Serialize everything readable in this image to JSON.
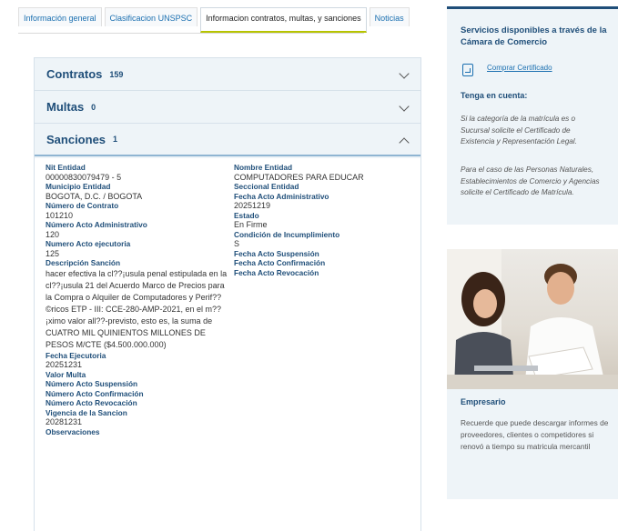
{
  "tabs": [
    {
      "label": "Información general"
    },
    {
      "label": "Clasificacion UNSPSC"
    },
    {
      "label": "Informacion contratos, multas, y sanciones"
    },
    {
      "label": "Noticias"
    }
  ],
  "sections": {
    "contratos": {
      "title": "Contratos",
      "count": "159"
    },
    "multas": {
      "title": "Multas",
      "count": "0"
    },
    "sanciones": {
      "title": "Sanciones",
      "count": "1"
    }
  },
  "sancion": {
    "nit_label": "Nit Entidad",
    "nit_value": "00000830079479 - 5",
    "municipio_label": "Municipio Entidad",
    "municipio_value": "BOGOTA, D.C. / BOGOTA",
    "contrato_label": "Número de Contrato",
    "contrato_value": "101210",
    "acto_adm_label": "Número Acto Administrativo",
    "acto_adm_value": "120",
    "acto_ejec_label": "Numero Acto ejecutoria",
    "acto_ejec_value": "125",
    "descripcion_label": "Descripción Sanción",
    "descripcion_value": "hacer efectiva la cl??¡usula penal estipulada en la cl??¡usula 21 del Acuerdo Marco de Precios para la Compra o Alquiler de Computadores y Perif??©ricos ETP - III: CCE-280-AMP-2021, en el m??¡ximo valor all??-previsto, esto es, la suma de CUATRO MIL QUINIENTOS MILLONES DE PESOS M/CTE ($4.500.000.000)",
    "fecha_ejec_label": "Fecha Ejecutoria",
    "fecha_ejec_value": "20251231",
    "valor_multa_label": "Valor Multa",
    "acto_susp_label": "Número Acto Suspensión",
    "acto_conf_label": "Número Acto Confirmación",
    "acto_rev_label": "Número Acto Revocación",
    "vigencia_label": "Vigencia de la Sancion",
    "vigencia_value": "20281231",
    "observaciones_label": "Observaciones",
    "nombre_label": "Nombre Entidad",
    "nombre_value": "COMPUTADORES PARA EDUCAR",
    "seccional_label": "Seccional Entidad",
    "fecha_acto_label": "Fecha Acto Administrativo",
    "fecha_acto_value": "20251219",
    "estado_label": "Estado",
    "estado_value": "En Firme",
    "condicion_label": "Condición de Incumplimiento",
    "condicion_value": "S",
    "fecha_susp_label": "Fecha Acto Suspensión",
    "fecha_conf_label": "Fecha Acto Confirmación",
    "fecha_rev_label": "Fecha Acto Revocación"
  },
  "sidebar": {
    "servicios_title": "Servicios disponibles a través de la Cámara de Comercio",
    "comprar_link": "Comprar Certificado",
    "tenga_title": "Tenga en cuenta:",
    "tenga_p1": "Si la categoría de la matrícula es o Sucursal solicite el Certificado de Existencia y Representación Legal.",
    "tenga_p2": "Para el caso de las Personas Naturales, Establecimientos de Comercio y Agencias solicite el Certificado de Matrícula.",
    "empresario_title": "Empresario",
    "empresario_text": "Recuerde que puede descargar informes de proveedores, clientes o competidores si renovó a tiempo su matricula mercantil"
  }
}
